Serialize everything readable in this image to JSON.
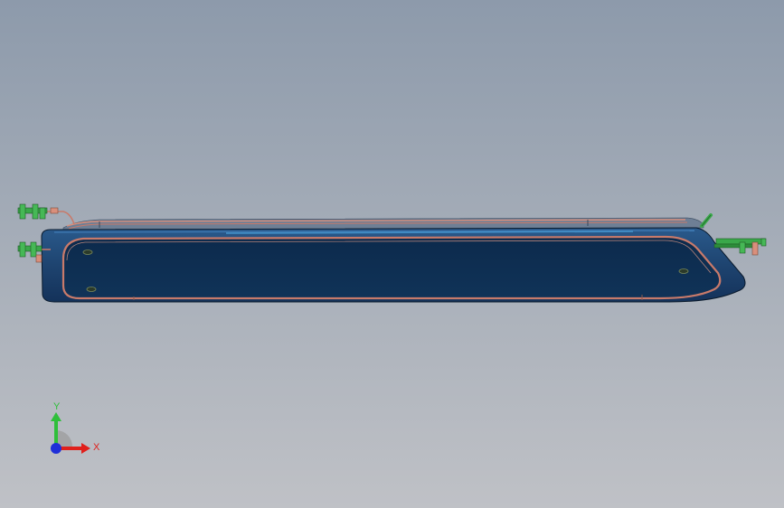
{
  "viewport": {
    "background_top": "#8d9aab",
    "background_bottom": "#bfc1c6"
  },
  "model": {
    "body_color": "#1e4470",
    "inner_color": "#0e2f52",
    "rim_color": "#c87a6a",
    "fitting_color": "#3aa84a"
  },
  "triad": {
    "x_label": "X",
    "y_label": "Y",
    "x_color": "#e0201c",
    "y_color": "#2fbf3a",
    "z_color": "#1f2fd8"
  }
}
